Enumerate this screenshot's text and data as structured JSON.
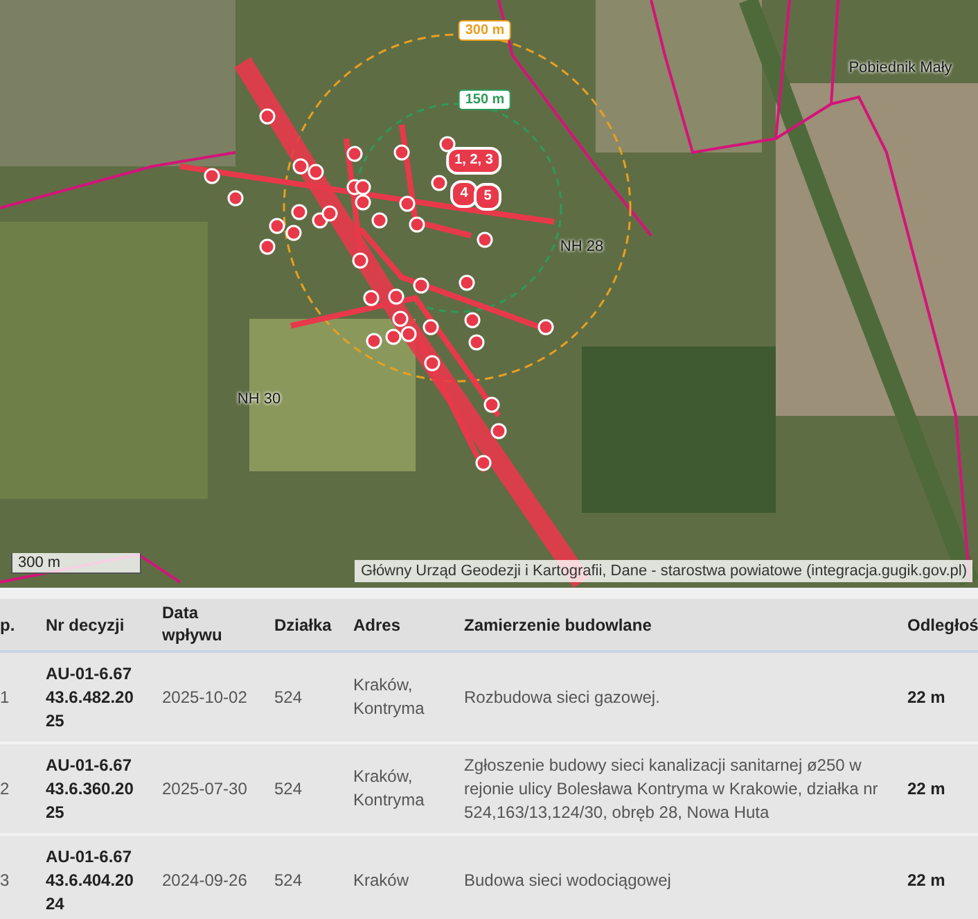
{
  "map": {
    "place_labels": [
      {
        "text": "Pobiednik Mały"
      },
      {
        "text": "NH 28"
      },
      {
        "text": "NH 30"
      }
    ],
    "radius_labels": [
      {
        "text": "300 m",
        "color": "#e8a020"
      },
      {
        "text": "150 m",
        "color": "#2e9a5a"
      }
    ],
    "markers": [
      {
        "label": "1, 2, 3"
      },
      {
        "label": "4"
      },
      {
        "label": "5"
      }
    ],
    "scale": "300 m",
    "attribution": "Główny Urząd Geodezji i Kartografii, Dane - starostwa powiatowe (integracja.gugik.gov.pl)"
  },
  "table": {
    "columns": [
      "p.",
      "Nr decyzji",
      "Data wpływu",
      "Działka",
      "Adres",
      "Zamierzenie budowlane",
      "Odległoś"
    ],
    "rows": [
      {
        "cells": [
          "1",
          "AU-01-6.6743.6.482.2025",
          "2025-10-02",
          "524",
          "Kraków, Kontryma",
          "Rozbudowa sieci gazowej.",
          "22 m"
        ]
      },
      {
        "cells": [
          "2",
          "AU-01-6.6743.6.360.2025",
          "2025-07-30",
          "524",
          "Kraków, Kontryma",
          "Zgłoszenie budowy sieci kanalizacji sanitarnej ø250 w rejonie ulicy Bolesława Kontryma w Krakowie, działka nr 524,163/13,124/30, obręb 28, Nowa Huta",
          "22 m"
        ]
      },
      {
        "cells": [
          "3",
          "AU-01-6.6743.6.404.2024",
          "2024-09-26",
          "524",
          "Kraków",
          "Budowa sieci wodociągowej",
          "22 m"
        ]
      }
    ]
  }
}
